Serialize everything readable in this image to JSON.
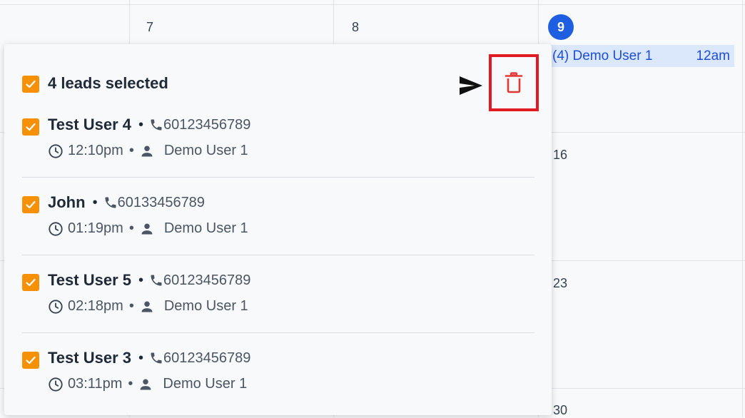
{
  "calendar": {
    "days": {
      "d7": "7",
      "d8": "8",
      "d9": "9",
      "d16": "16",
      "d23": "23",
      "d30": "30"
    },
    "event": {
      "label": "(4) Demo User 1",
      "time": "12am"
    },
    "colors": {
      "today": "#1d5fe0",
      "event_bg": "#dbe7fb",
      "event_text": "#1d4ed8"
    }
  },
  "panel": {
    "header": {
      "selected_label": "4 leads selected",
      "send_icon": "send-icon",
      "delete_icon": "trash-icon"
    },
    "leads": [
      {
        "name": "Test User 4",
        "phone": "60123456789",
        "time": "12:10pm",
        "owner": "Demo User 1",
        "checked": true
      },
      {
        "name": "John",
        "phone": "60133456789",
        "time": "01:19pm",
        "owner": "Demo User 1",
        "checked": true
      },
      {
        "name": "Test User 5",
        "phone": "60123456789",
        "time": "02:18pm",
        "owner": "Demo User 1",
        "checked": true
      },
      {
        "name": "Test User 3",
        "phone": "60123456789",
        "time": "03:11pm",
        "owner": "Demo User 1",
        "checked": true
      }
    ],
    "bullet": "•",
    "colors": {
      "checkbox": "#f59007",
      "delete_highlight": "#e01b24",
      "delete_icon": "#e53935"
    }
  }
}
